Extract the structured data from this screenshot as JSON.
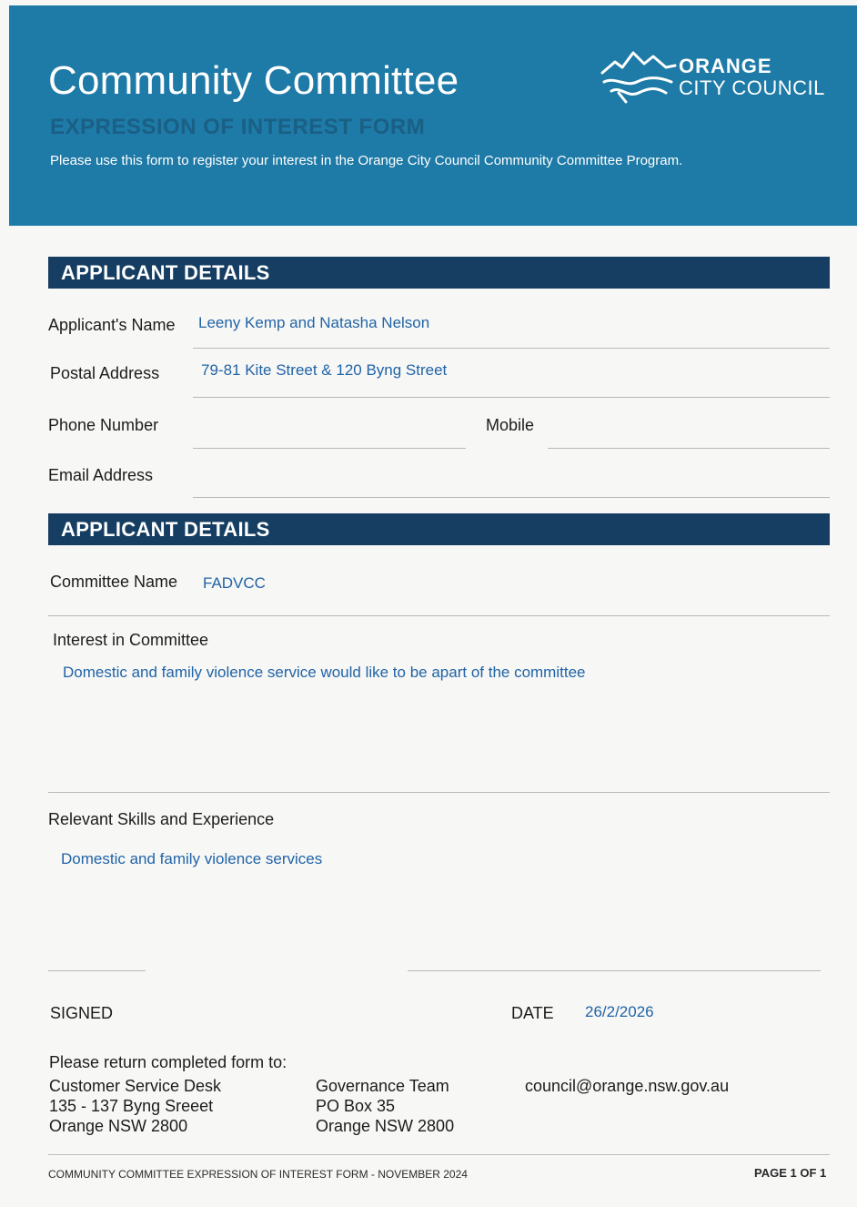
{
  "header": {
    "title": "Community Committee",
    "subtitle": "EXPRESSION OF INTEREST FORM",
    "intro": "Please use this form to register your interest in the Orange City Council Community Committee Program.",
    "logo_line1": "ORANGE",
    "logo_line2": "CITY COUNCIL"
  },
  "section1": {
    "title": "APPLICANT DETAILS",
    "name_label": "Applicant's Name",
    "name_value": "Leeny Kemp and Natasha Nelson",
    "address_label": "Postal Address",
    "address_value": "79-81 Kite Street & 120 Byng Street",
    "phone_label": "Phone Number",
    "mobile_label": "Mobile",
    "email_label": "Email Address"
  },
  "section2": {
    "title": "APPLICANT DETAILS",
    "committee_label": "Committee Name",
    "committee_value": "FADVCC",
    "interest_label": "Interest in Committee",
    "interest_value": "Domestic and family violence service would like to be apart of the committee",
    "skills_label": "Relevant Skills and Experience",
    "skills_value": "Domestic and family violence services"
  },
  "signoff": {
    "signed_label": "SIGNED",
    "date_label": "DATE",
    "date_value": "26/2/2026"
  },
  "return": {
    "heading": "Please return completed form to:",
    "col1": [
      "Customer Service Desk",
      "135 - 137 Byng Sreeet",
      "Orange NSW 2800"
    ],
    "col2": [
      "Governance Team",
      "PO Box 35",
      "Orange NSW 2800"
    ],
    "email": "council@orange.nsw.gov.au"
  },
  "footer": {
    "left": "COMMUNITY COMMITTEE EXPRESSION OF INTEREST FORM - NOVEMBER 2024",
    "right": "PAGE 1 OF 1"
  },
  "colors": {
    "header_bg": "#1e7aa6",
    "section_bg": "#163e63",
    "handwriting": "#2164a6"
  }
}
